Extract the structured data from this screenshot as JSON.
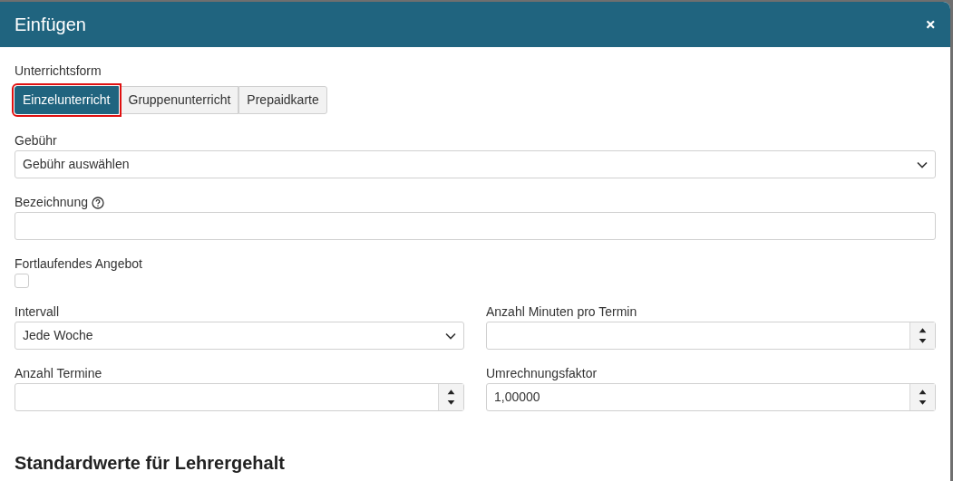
{
  "dialog": {
    "title": "Einfügen",
    "close": "×"
  },
  "lesson_form": {
    "label": "Unterrichtsform",
    "options": [
      {
        "label": "Einzelunterricht",
        "selected": true,
        "highlighted": true
      },
      {
        "label": "Gruppenunterricht",
        "selected": false,
        "highlighted": false
      },
      {
        "label": "Prepaidkarte",
        "selected": false,
        "highlighted": false
      }
    ]
  },
  "fields": [
    {
      "kind": "select",
      "label": "Gebühr",
      "value": "Gebühr auswählen",
      "help": false
    },
    {
      "kind": "text",
      "label": "Bezeichnung",
      "help": true
    },
    {
      "kind": "checkbox",
      "label": "Fortlaufendes Angebot",
      "checked": false
    }
  ],
  "columns": [
    [
      {
        "kind": "select",
        "label": "Intervall",
        "value": "Jede Woche"
      },
      {
        "kind": "number",
        "label": "Anzahl Termine"
      }
    ],
    [
      {
        "kind": "number",
        "label": "Anzahl Minuten pro Termin"
      },
      {
        "kind": "number",
        "label": "Umrechnungsfaktor",
        "value": "1,00000"
      }
    ]
  ],
  "section_heading": "Standardwerte für Lehrergehalt"
}
